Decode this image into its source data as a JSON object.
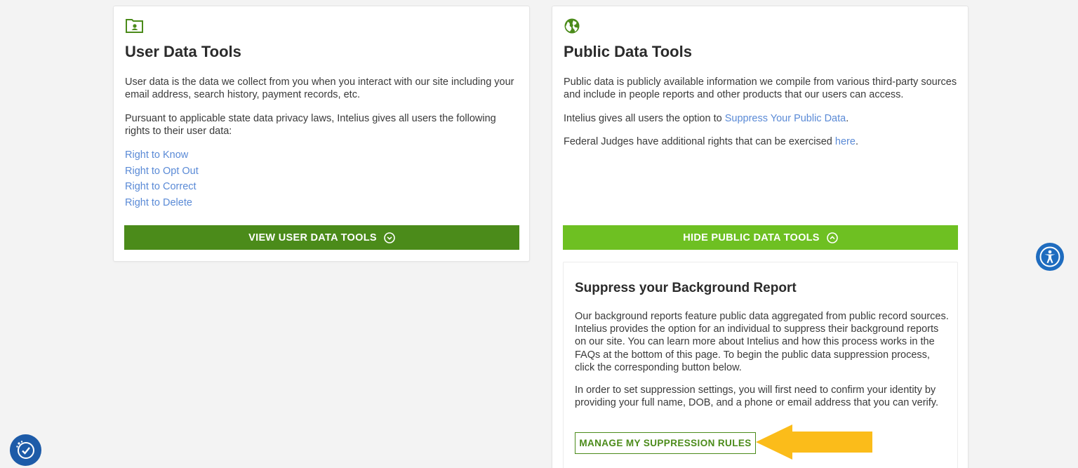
{
  "user_card": {
    "icon": "contact-card-icon",
    "title": "User Data Tools",
    "para1": "User data is the data we collect from you when you interact with our site including your email address, search history, payment records, etc.",
    "para2": "Pursuant to applicable state data privacy laws, Intelius gives all users the following rights to their user data:",
    "rights": [
      "Right to Know",
      "Right to Opt Out",
      "Right to Correct",
      "Right to Delete"
    ],
    "button_label": "VIEW USER DATA TOOLS",
    "button_icon": "chevron-down-circle-icon"
  },
  "public_card": {
    "icon": "globe-icon",
    "title": "Public Data Tools",
    "para1": "Public data is publicly available information we compile from various third-party sources and include in people reports and other products that our users can access.",
    "para2_prefix": "Intelius gives all users the option to ",
    "para2_link": "Suppress Your Public Data",
    "para2_suffix": ".",
    "para3_prefix": "Federal Judges have additional rights that can be exercised ",
    "para3_link": "here",
    "para3_suffix": ".",
    "button_label": "HIDE PUBLIC DATA TOOLS",
    "button_icon": "chevron-up-circle-icon"
  },
  "suppress": {
    "title": "Suppress your Background Report",
    "para1": "Our background reports feature public data aggregated from public record sources. Intelius provides the option for an individual to suppress their background reports on our site. You can learn more about Intelius and how this process works in the FAQs at the bottom of this page. To begin the public data suppression process, click the corresponding button below.",
    "para2": "In order to set suppression settings, you will first need to confirm your identity by providing your full name, DOB, and a phone or email address that you can verify.",
    "button_label": "MANAGE MY SUPPRESSION RULES"
  },
  "widgets": {
    "accessibility_icon": "accessibility-icon",
    "consent_icon": "privacy-consent-icon"
  },
  "colors": {
    "dark_green": "#4b8b1a",
    "light_green": "#6ec022",
    "link_blue": "#5a8ad6",
    "arrow_yellow": "#fbbc1a",
    "a11y_blue": "#1f6cbf"
  }
}
